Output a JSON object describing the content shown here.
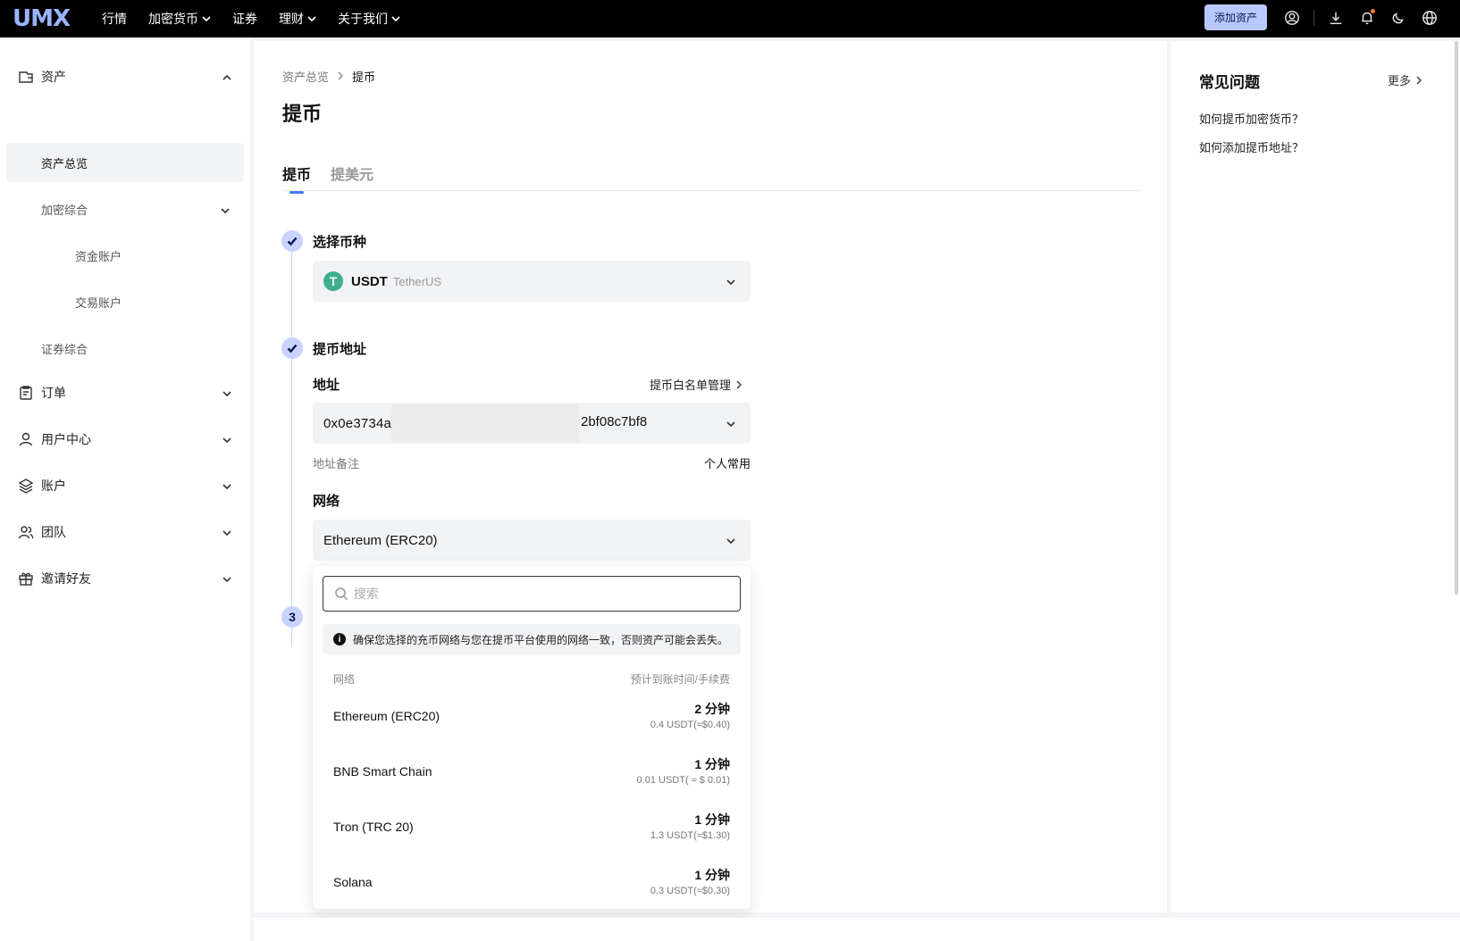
{
  "app": {
    "logo_text": "UMX"
  },
  "topnav": {
    "items": [
      {
        "label": "行情",
        "has_dropdown": false
      },
      {
        "label": "加密货币",
        "has_dropdown": true
      },
      {
        "label": "证券",
        "has_dropdown": false
      },
      {
        "label": "理财",
        "has_dropdown": true
      },
      {
        "label": "关于我们",
        "has_dropdown": true
      }
    ],
    "add_asset_label": "添加资产",
    "icons": [
      "user-circle-icon",
      "download-icon",
      "bell-icon",
      "moon-icon",
      "globe-icon"
    ],
    "notification_dot_color": "#ff7a1a"
  },
  "sidebar": {
    "assets": {
      "label": "资产",
      "icon": "wallet-icon"
    },
    "overview": {
      "label": "资产总览"
    },
    "crypto": {
      "label": "加密综合"
    },
    "funding": {
      "label": "资金账户"
    },
    "trading": {
      "label": "交易账户"
    },
    "securities": {
      "label": "证券综合"
    },
    "orders": {
      "label": "订单",
      "icon": "clipboard-icon"
    },
    "user_center": {
      "label": "用户中心",
      "icon": "user-icon"
    },
    "account": {
      "label": "账户",
      "icon": "layers-icon"
    },
    "team": {
      "label": "团队",
      "icon": "team-icon"
    },
    "invite": {
      "label": "邀请好友",
      "icon": "gift-icon"
    }
  },
  "main": {
    "breadcrumb": {
      "parent": "资产总览",
      "current": "提币"
    },
    "title": "提币",
    "tabs": {
      "active": "提币",
      "inactive": "提美元"
    },
    "step1": {
      "title": "选择币种",
      "coin_symbol": "USDT",
      "coin_name": "TetherUS",
      "coin_icon_letter": "T",
      "coin_color": "#3fae8d"
    },
    "step2": {
      "title": "提币地址",
      "address_label": "地址",
      "whitelist_label": "提币白名单管理",
      "address_visible_start": "0x0e3734a",
      "address_visible_end": "2bf08c7bf8",
      "memo_label": "地址备注",
      "memo_value": "个人常用",
      "network_label": "网络",
      "network_selected": "Ethereum (ERC20)"
    },
    "step3": {
      "number": "3"
    },
    "dropdown": {
      "search_placeholder": "搜索",
      "warning_icon": "i",
      "warning_text": "确保您选择的充币网络与您在提币平台使用的网络一致，否则资产可能会丢失。",
      "col_left": "网络",
      "col_right": "预计到账时间/手续费",
      "networks": [
        {
          "name": "Ethereum (ERC20)",
          "time": "2 分钟",
          "fee": "0.4 USDT(≈$0.40)"
        },
        {
          "name": "BNB Smart Chain",
          "time": "1 分钟",
          "fee": "0.01 USDT( ≈ $ 0.01)"
        },
        {
          "name": "Tron (TRC 20)",
          "time": "1 分钟",
          "fee": "1.3 USDT(≈$1.30)"
        },
        {
          "name": "Solana",
          "time": "1 分钟",
          "fee": "0.3 USDT(≈$0.30)"
        }
      ]
    },
    "accent_color": "#3d7cff",
    "step_color": "#c8d4ff"
  },
  "faq": {
    "title": "常见问题",
    "more_label": "更多",
    "items": [
      "如何提币加密货币？",
      "如何添加提币地址？"
    ]
  }
}
